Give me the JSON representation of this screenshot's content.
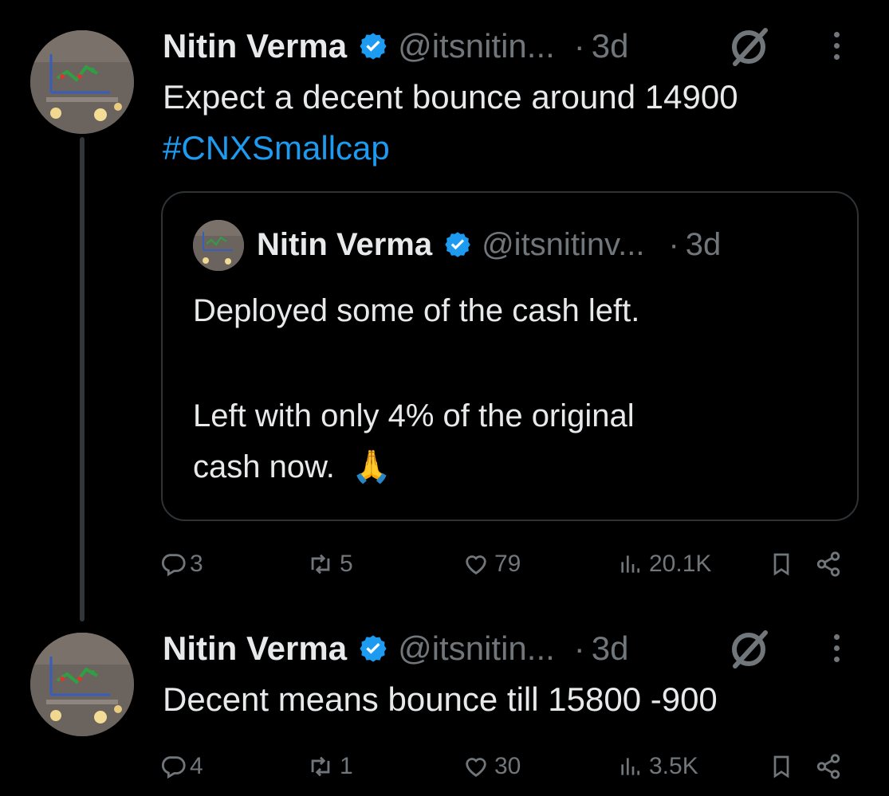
{
  "tweet1": {
    "author_name": "Nitin Verma",
    "handle": "@itsnitin...",
    "dot": "·",
    "time": "3d",
    "text": "Expect a decent bounce around 14900",
    "hashtag": "#CNXSmallcap",
    "quote": {
      "author_name": "Nitin Verma",
      "handle": "@itsnitinv...",
      "dot": "·",
      "time": "3d",
      "line1": "Deployed some of the cash left.",
      "line2": "Left with only 4% of the original",
      "line3": "cash now.",
      "emoji": "🙏"
    },
    "stats": {
      "replies": "3",
      "reposts": "5",
      "likes": "79",
      "views": "20.1K"
    }
  },
  "tweet2": {
    "author_name": "Nitin Verma",
    "handle": "@itsnitin...",
    "dot": "·",
    "time": "3d",
    "text": "Decent means bounce till 15800 -900",
    "stats": {
      "replies": "4",
      "reposts": "1",
      "likes": "30",
      "views": "3.5K"
    }
  },
  "colors": {
    "background": "#000000",
    "text_primary": "#e7e9ea",
    "text_secondary": "#71767b",
    "link": "#1d9bf0",
    "verified": "#1d9bf0",
    "border": "#2f3336"
  },
  "icons": [
    "verified-badge-icon",
    "grok-icon",
    "more-icon",
    "reply-icon",
    "repost-icon",
    "like-icon",
    "views-icon",
    "bookmark-icon",
    "share-icon"
  ]
}
